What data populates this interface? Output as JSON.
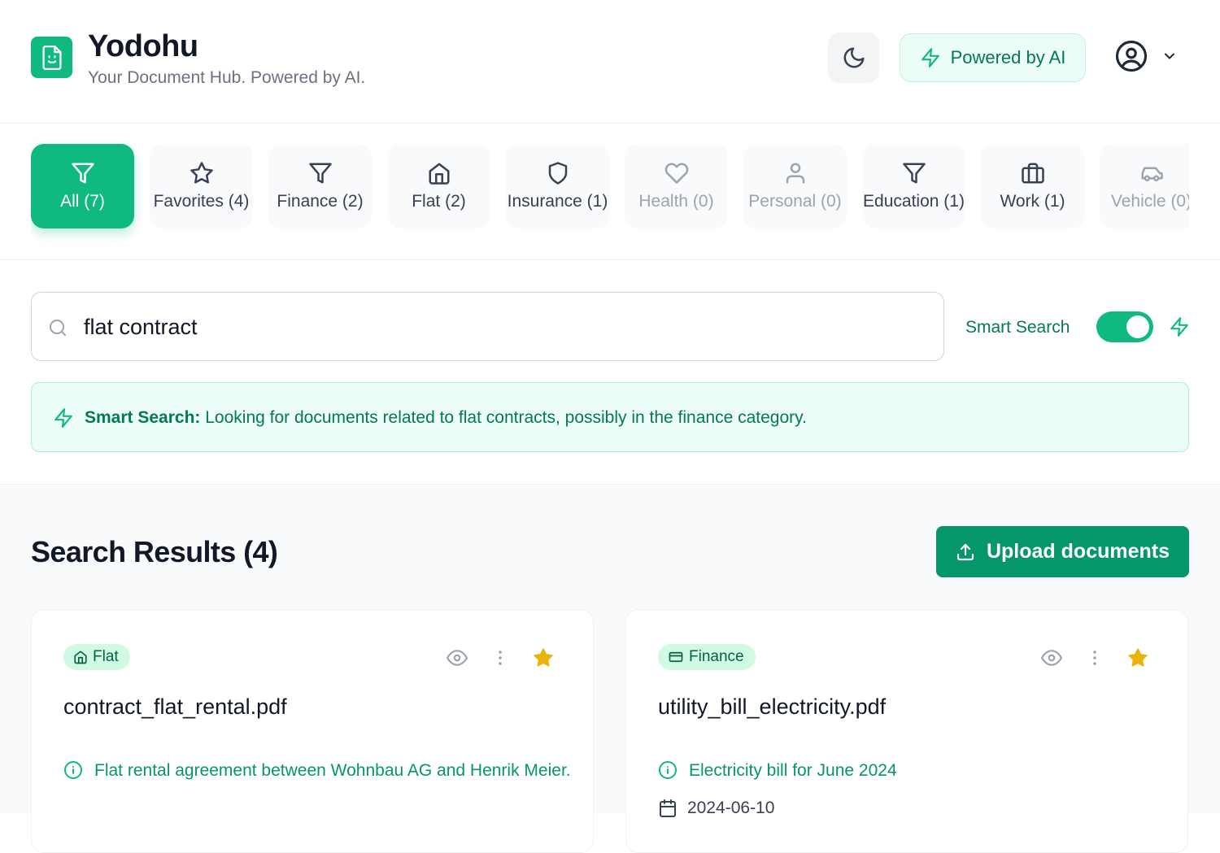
{
  "app": {
    "title": "Yodohu",
    "subtitle": "Your Document Hub. Powered by AI.",
    "ai_badge": "Powered by AI"
  },
  "tabs": [
    {
      "label": "All (7)",
      "icon": "filter-icon",
      "state": "active"
    },
    {
      "label": "Favorites (4)",
      "icon": "star-icon",
      "state": "normal"
    },
    {
      "label": "Finance (2)",
      "icon": "filter-icon",
      "state": "normal"
    },
    {
      "label": "Flat (2)",
      "icon": "home-icon",
      "state": "normal"
    },
    {
      "label": "Insurance (1)",
      "icon": "shield-icon",
      "state": "normal"
    },
    {
      "label": "Health (0)",
      "icon": "heart-icon",
      "state": "muted"
    },
    {
      "label": "Personal (0)",
      "icon": "user-icon",
      "state": "muted"
    },
    {
      "label": "Education (1)",
      "icon": "filter-icon",
      "state": "normal"
    },
    {
      "label": "Work (1)",
      "icon": "briefcase-icon",
      "state": "normal"
    },
    {
      "label": "Vehicle (0)",
      "icon": "car-icon",
      "state": "muted"
    }
  ],
  "search": {
    "value": "flat contract",
    "smart_label": "Smart Search",
    "smart_enabled": true,
    "info_prefix": "Smart Search:",
    "info_text": " Looking for documents related to flat contracts, possibly in the finance category."
  },
  "results": {
    "title": "Search Results (4)",
    "upload_label": "Upload documents"
  },
  "cards": [
    {
      "category": "Flat",
      "category_icon": "home-icon",
      "filename": "contract_flat_rental.pdf",
      "description": "Flat rental agreement between Wohnbau AG and Henrik Meier.",
      "favorite": true
    },
    {
      "category": "Finance",
      "category_icon": "credit-card-icon",
      "filename": "utility_bill_electricity.pdf",
      "description": "Electricity bill for June 2024",
      "date": "2024-06-10",
      "favorite": true
    }
  ],
  "colors": {
    "accent": "#10b981",
    "accent_dark": "#059669",
    "accent_text": "#047857",
    "star": "#eab308"
  }
}
